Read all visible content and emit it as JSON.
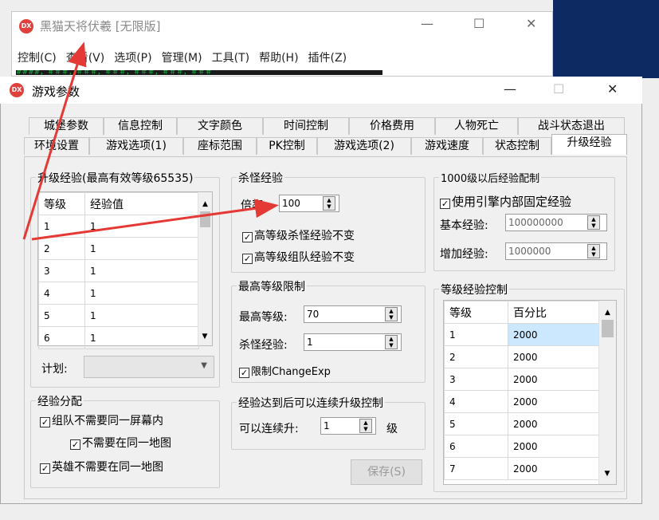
{
  "bg_window": {
    "title": "黑猫天将伏羲 [无限版]",
    "logo": "DX",
    "menu": [
      "控制(C)",
      "查看(V)",
      "选项(P)",
      "管理(M)",
      "工具(T)",
      "帮助(H)",
      "插件(Z)"
    ],
    "minimize": "—",
    "maximize": "☐",
    "close": "✕",
    "status_text": "####，＃＃＃，＃＃＃，＃＃＃，＃＃＃，＃＃＃，＃＃＃"
  },
  "dialog": {
    "title": "游戏参数",
    "logo": "DX",
    "minimize": "—",
    "maximize": "☐",
    "close": "✕",
    "tabs_row1": [
      "城堡参数",
      "信息控制",
      "文字颜色",
      "时间控制",
      "价格费用",
      "人物死亡",
      "战斗状态退出"
    ],
    "tabs_row2": [
      "环境设置",
      "游戏选项(1)",
      "座标范围",
      "PK控制",
      "游戏选项(2)",
      "游戏速度",
      "状态控制",
      "升级经验"
    ],
    "active_tab": "升级经验"
  },
  "level_exp": {
    "title": "升级经验(最高有效等级65535)",
    "col_level": "等级",
    "col_exp": "经验值",
    "rows": [
      [
        "1",
        "1"
      ],
      [
        "2",
        "1"
      ],
      [
        "3",
        "1"
      ],
      [
        "4",
        "1"
      ],
      [
        "5",
        "1"
      ],
      [
        "6",
        "1"
      ]
    ],
    "plan_label": "计划:"
  },
  "exp_distribution": {
    "title": "经验分配",
    "opt1": "组队不需要同一屏幕内",
    "opt2": "不需要在同一地图",
    "opt3": "英雄不需要在同一地图"
  },
  "kill_exp": {
    "title": "杀怪经验",
    "rate_label": "倍率:",
    "rate_value": "100",
    "opt1": "高等级杀怪经验不变",
    "opt2": "高等级组队经验不变"
  },
  "max_level": {
    "title": "最高等级限制",
    "max_label": "最高等级:",
    "max_value": "70",
    "kill_label": "杀怪经验:",
    "kill_value": "1",
    "limit_label": "限制ChangeExp"
  },
  "continuous": {
    "title": "经验达到后可以连续升级控制",
    "label": "可以连续升:",
    "value": "1",
    "unit": "级"
  },
  "over1000": {
    "title": "1000级以后经验配制",
    "use_engine": "使用引擎内部固定经验",
    "base_label": "基本经验:",
    "base_value": "100000000",
    "inc_label": "增加经验:",
    "inc_value": "1000000"
  },
  "level_exp_ctrl": {
    "title": "等级经验控制",
    "col_level": "等级",
    "col_pct": "百分比",
    "rows": [
      [
        "1",
        "2000"
      ],
      [
        "2",
        "2000"
      ],
      [
        "3",
        "2000"
      ],
      [
        "4",
        "2000"
      ],
      [
        "5",
        "2000"
      ],
      [
        "6",
        "2000"
      ],
      [
        "7",
        "2000"
      ]
    ]
  },
  "save_button": "保存(S)",
  "colors": {
    "arrow": "#e53935",
    "logo": "#e0413d",
    "selection": "#cce8ff",
    "bg_right": "#0e2a63"
  }
}
